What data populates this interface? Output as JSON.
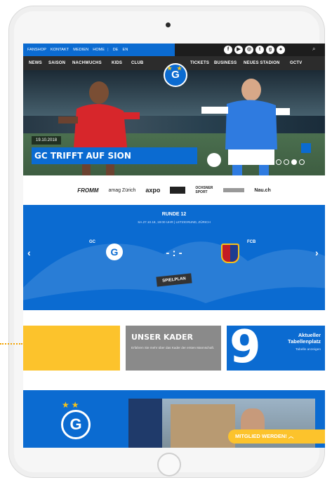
{
  "topbar": {
    "links": [
      "FANSHOP",
      "KONTAKT",
      "MEDIEN",
      "HOME"
    ],
    "lang": [
      "DE",
      "EN"
    ]
  },
  "nav": [
    "NEWS",
    "SAISON",
    "NACHWUCHS",
    "KIDS",
    "CLUB",
    "TICKETS",
    "BUSINESS",
    "NEUES STADION",
    "GCTV"
  ],
  "hero": {
    "date": "19.10.2018",
    "title": "GC TRIFFT AUF SION"
  },
  "sponsors": [
    "FROMM",
    "amag Zürich",
    "axpo",
    "",
    "OCHSNER SPORT",
    "",
    "Nau.ch"
  ],
  "match": {
    "round": "RUNDE 12",
    "info": "SA.27.10.18, 19:00 UHR | LETZIGRUND, ZÜRICH",
    "home": "GC",
    "away": "FCB",
    "score": "- : -",
    "button": "SPIELPLAN"
  },
  "tiles": {
    "kader_title": "UNSER KADER",
    "kader_text": "Erfahren Sie mehr über das Kader der ersten Mannschaft.",
    "table_number": "9",
    "table_title": "Aktueller Tabellenplatz",
    "table_link": "Tabelle anzeigen"
  },
  "bottom": {
    "cta": "MITGLIED WERDEN!"
  },
  "colors": {
    "brand": "#0b6bd1",
    "accent": "#fcc32c",
    "dark": "#2c2c2c"
  }
}
